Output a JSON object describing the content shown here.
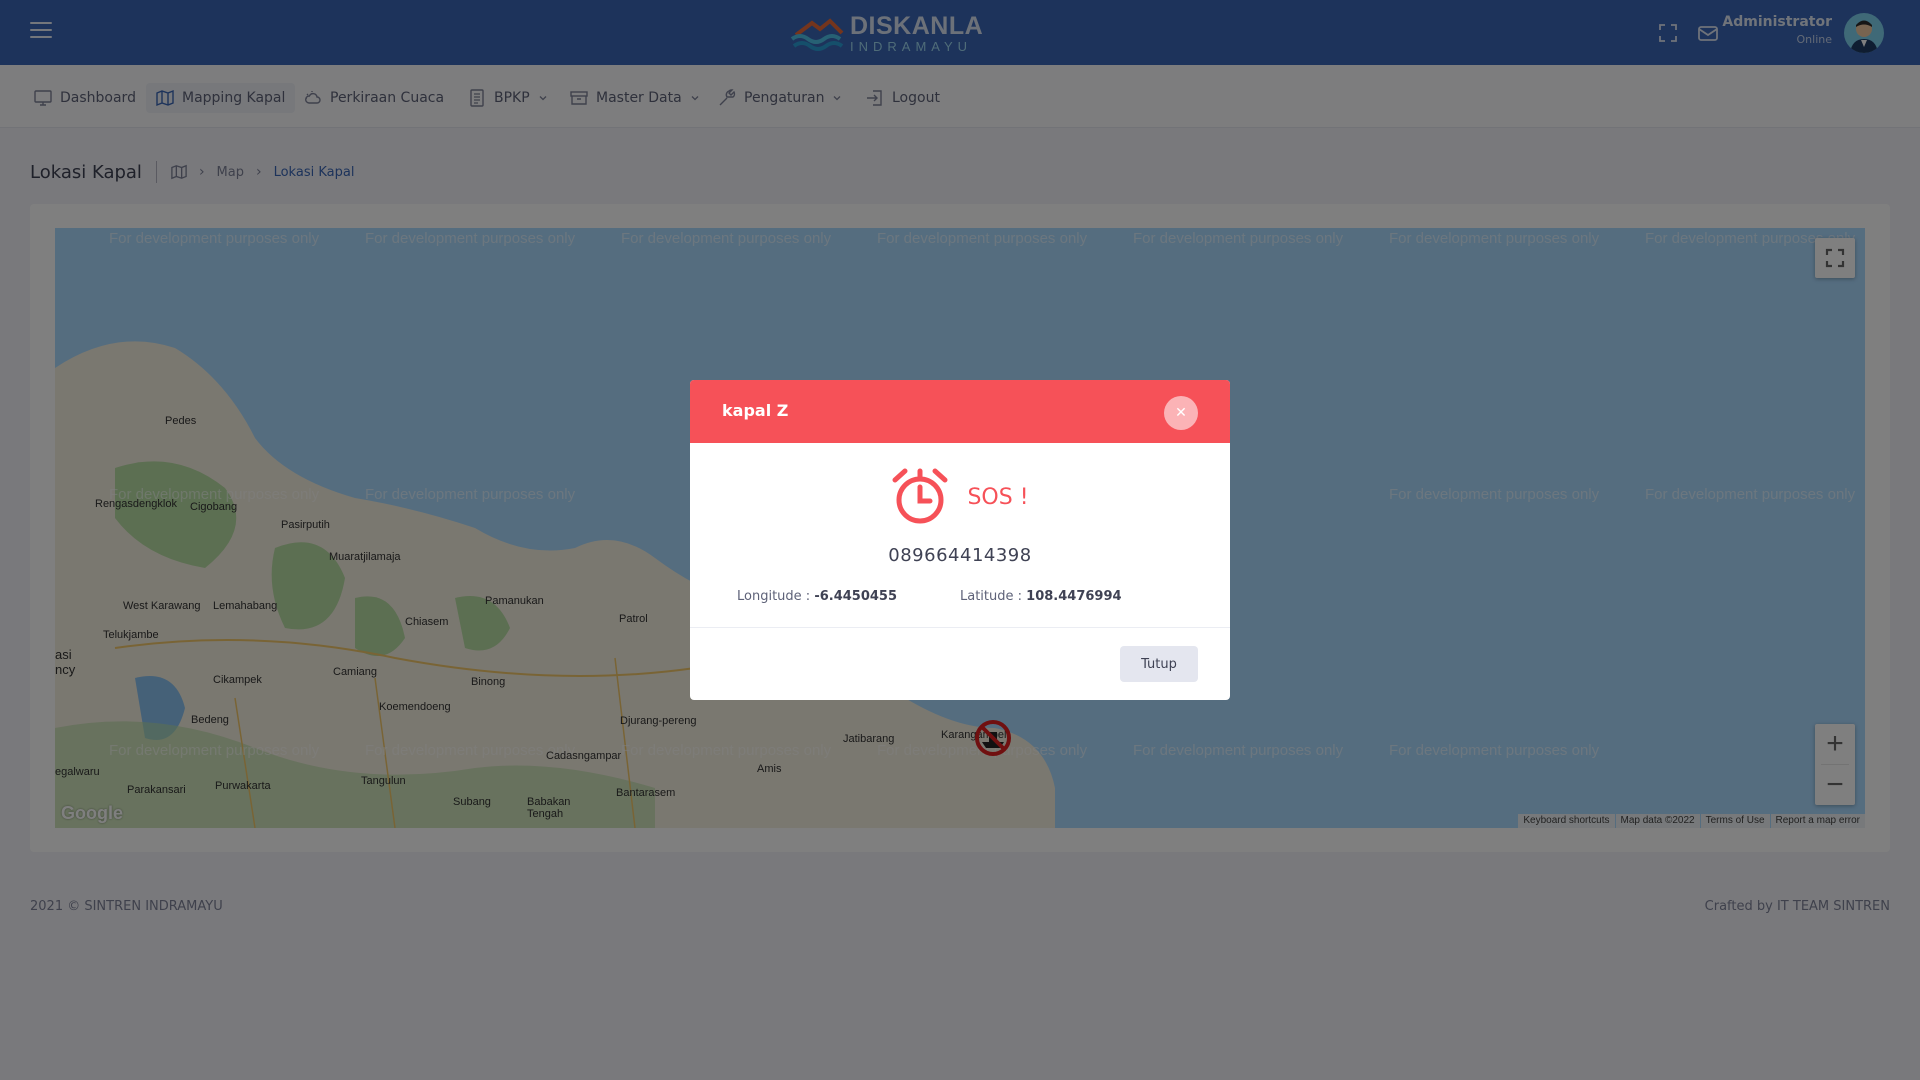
{
  "header": {
    "logo_title": "DISKANLA",
    "logo_subtitle": "INDRAMAYU",
    "user_name": "Administrator",
    "user_status": "Online",
    "icons": [
      "fullscreen-icon",
      "mail-icon"
    ]
  },
  "nav": {
    "items": [
      {
        "label": "Dashboard",
        "icon": "monitor-icon"
      },
      {
        "label": "Mapping Kapal",
        "icon": "map-icon",
        "active": true
      },
      {
        "label": "Perkiraan Cuaca",
        "icon": "cloud-icon"
      },
      {
        "label": "BPKP",
        "icon": "document-icon",
        "dropdown": true
      },
      {
        "label": "Master Data",
        "icon": "archive-icon",
        "dropdown": true
      },
      {
        "label": "Pengaturan",
        "icon": "wrench-icon",
        "dropdown": true
      },
      {
        "label": "Logout",
        "icon": "logout-icon"
      }
    ]
  },
  "breadcrumb": {
    "title": "Lokasi Kapal",
    "items": [
      "Map",
      "Lokasi Kapal"
    ]
  },
  "map": {
    "watermark": "For development purposes only",
    "places": [
      "Pedes",
      "Rengasdengklok",
      "Cigobang",
      "Pasirputih",
      "Muaratjilamaja",
      "West Karawang",
      "Telukjambe",
      "Lemahabang",
      "Chiasem",
      "Pamanukan",
      "Patrol",
      "Cikampek",
      "Camiang",
      "Binong",
      "Bedeng",
      "Koemendoeng",
      "Djurang-pereng",
      "Jatibarang",
      "Karangampel",
      "Cadasngampar",
      "Amis",
      "Purwakarta",
      "Tangulun",
      "Parakansari",
      "Subang",
      "Babakan Tengah",
      "Bantarasem",
      "egalwaru",
      "asi",
      "ncy"
    ],
    "attribution": [
      "Keyboard shortcuts",
      "Map data ©2022",
      "Terms of Use",
      "Report a map error"
    ],
    "google_logo": "Google",
    "colors": {
      "sea": "#aadaff",
      "land": "#f5f0e1",
      "forest": "#b8dea4"
    }
  },
  "modal": {
    "title": "kapal Z",
    "alert_text": "SOS !",
    "phone": "089664414398",
    "longitude_label": "Longitude :",
    "longitude_value": "-6.4450455",
    "latitude_label": "Latitude :",
    "latitude_value": "108.4476994",
    "close_label": "Tutup",
    "accent_color": "#f65158"
  },
  "footer": {
    "left": "2021 © SINTREN INDRAMAYU",
    "right": "Crafted by IT TEAM SINTREN"
  }
}
